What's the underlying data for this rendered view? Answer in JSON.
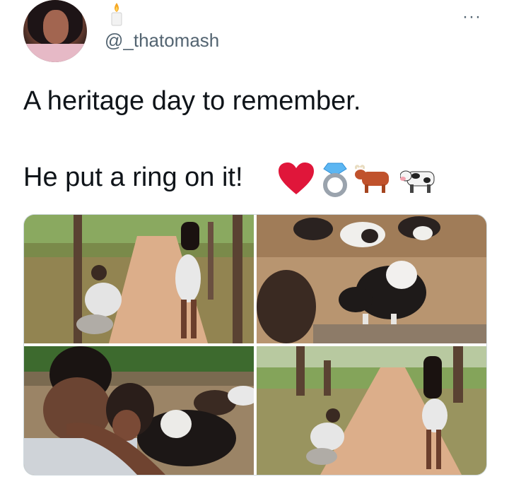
{
  "user": {
    "handle": "@_thatomash",
    "avatar_icon": "profile-photo",
    "badge_icon": "candle-icon"
  },
  "tweet": {
    "line1": "A heritage day to remember.",
    "line2": "He put a ring on it!",
    "emoji_icons": [
      "red-heart-icon",
      "ring-icon",
      "ox-icon",
      "cow-icon"
    ]
  },
  "menu": {
    "more_label": "···"
  },
  "media": {
    "photos": [
      {
        "alt_icon": "proposal-photo-dirt-road"
      },
      {
        "alt_icon": "cows-photo"
      },
      {
        "alt_icon": "hug-photo"
      },
      {
        "alt_icon": "proposal-photo-wide"
      }
    ]
  },
  "colors": {
    "text": "#0f1419",
    "secondary": "#536471",
    "heart": "#e0163a",
    "border": "#cfd9de"
  }
}
